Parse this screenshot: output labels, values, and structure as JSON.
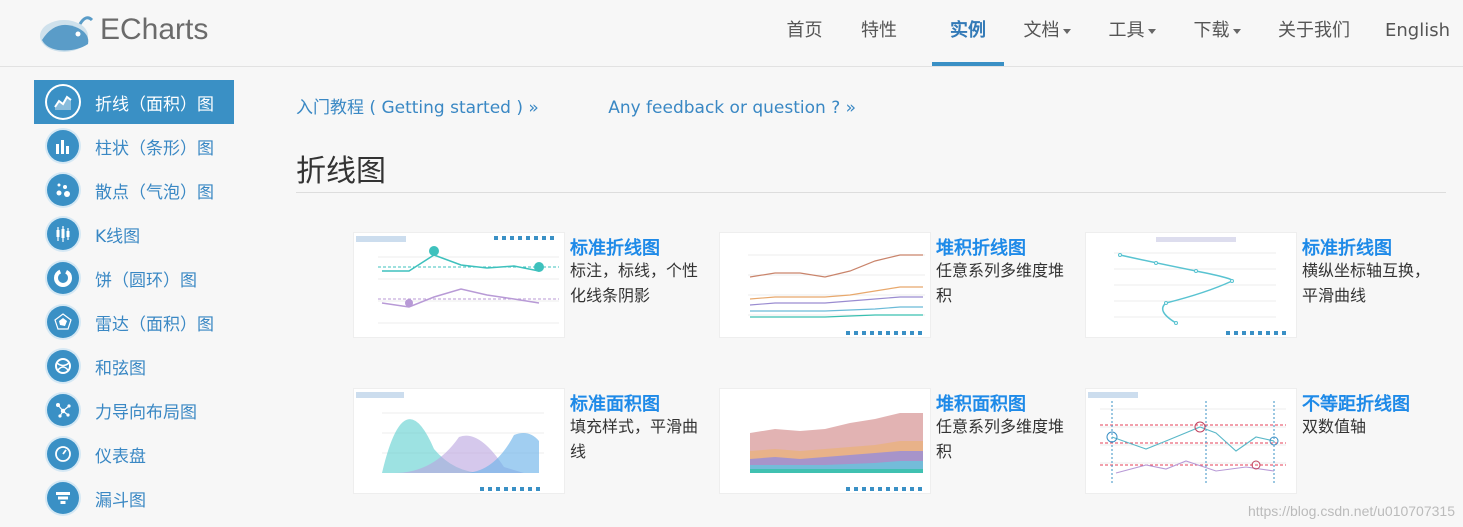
{
  "brand": {
    "name": "ECharts"
  },
  "nav": [
    {
      "label": "首页",
      "active": false,
      "dropdown": false
    },
    {
      "label": "特性",
      "active": false,
      "dropdown": false
    },
    {
      "label": "实例",
      "active": true,
      "dropdown": false
    },
    {
      "label": "文档",
      "active": false,
      "dropdown": true
    },
    {
      "label": "工具",
      "active": false,
      "dropdown": true
    },
    {
      "label": "下载",
      "active": false,
      "dropdown": true
    },
    {
      "label": "关于我们",
      "active": false,
      "dropdown": false
    },
    {
      "label": "English",
      "active": false,
      "dropdown": false
    }
  ],
  "sidebar": {
    "items": [
      {
        "label": "折线（面积）图",
        "icon": "line-chart-icon",
        "active": true
      },
      {
        "label": "柱状（条形）图",
        "icon": "bar-chart-icon",
        "active": false
      },
      {
        "label": "散点（气泡）图",
        "icon": "scatter-chart-icon",
        "active": false
      },
      {
        "label": "K线图",
        "icon": "candlestick-icon",
        "active": false
      },
      {
        "label": "饼（圆环）图",
        "icon": "pie-chart-icon",
        "active": false
      },
      {
        "label": "雷达（面积）图",
        "icon": "radar-chart-icon",
        "active": false
      },
      {
        "label": "和弦图",
        "icon": "chord-chart-icon",
        "active": false
      },
      {
        "label": "力导向布局图",
        "icon": "force-graph-icon",
        "active": false
      },
      {
        "label": "仪表盘",
        "icon": "gauge-icon",
        "active": false
      },
      {
        "label": "漏斗图",
        "icon": "funnel-chart-icon",
        "active": false
      }
    ]
  },
  "links": {
    "getting_started": "入门教程 ( Getting started ) »",
    "feedback": "Any feedback or question ? »"
  },
  "section": {
    "title": "折线图"
  },
  "cards": [
    {
      "title": "标准折线图",
      "desc": "标注，标线，个性化线条阴影",
      "thumb": "temperature-line"
    },
    {
      "title": "堆积折线图",
      "desc": "任意系列多维度堆积",
      "thumb": "stacked-line"
    },
    {
      "title": "标准折线图",
      "desc": "横纵坐标轴互换，平滑曲线",
      "thumb": "vertical-line"
    },
    {
      "title": "标准面积图",
      "desc": "填充样式，平滑曲线",
      "thumb": "smooth-area"
    },
    {
      "title": "堆积面积图",
      "desc": "任意系列多维度堆积",
      "thumb": "stacked-area"
    },
    {
      "title": "不等距折线图",
      "desc": "双数值轴",
      "thumb": "value-axis-line"
    }
  ],
  "watermark": "https://blog.csdn.net/u010707315",
  "colors": {
    "accent": "#3a90c5",
    "title_blue": "#1e8ae8"
  }
}
